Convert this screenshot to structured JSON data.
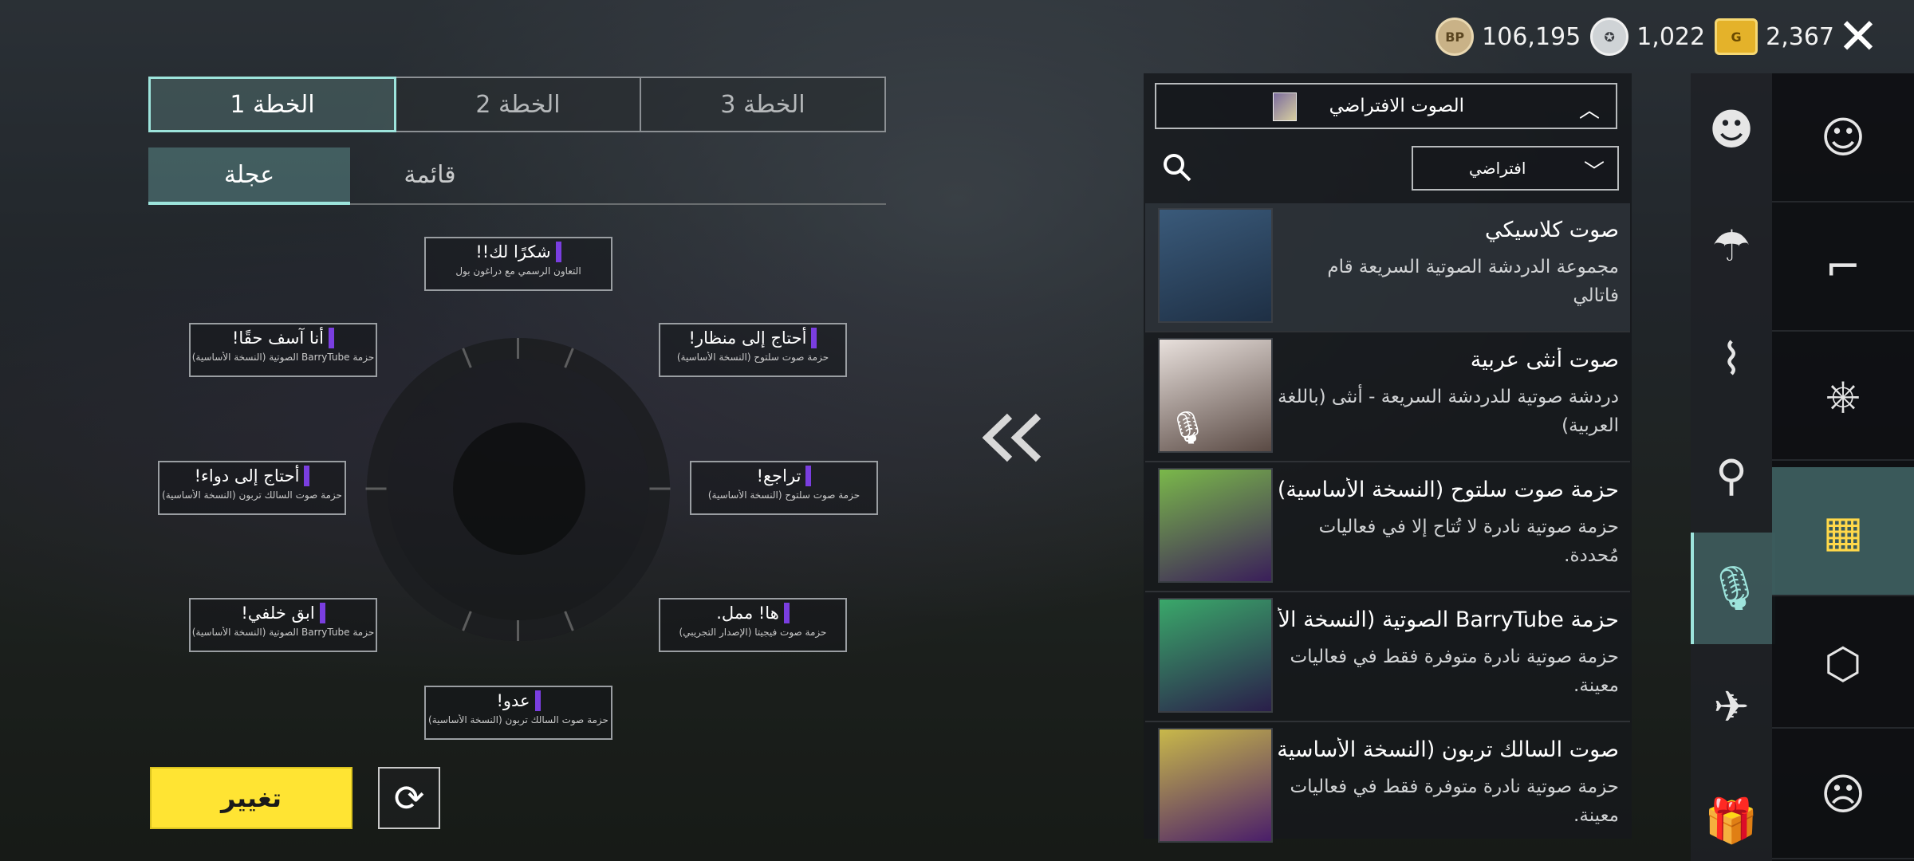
{
  "currency": [
    {
      "icon": "bp-coin-icon",
      "symbol": "BP",
      "value": "106,195"
    },
    {
      "icon": "ag-coin-icon",
      "symbol": "",
      "value": "1,022"
    },
    {
      "icon": "g-coin-icon",
      "symbol": "G",
      "value": "2,367"
    }
  ],
  "close_icon": "close-icon",
  "plans": [
    {
      "label": "الخطة 1",
      "active": true
    },
    {
      "label": "الخطة 2",
      "active": false
    },
    {
      "label": "الخطة 3",
      "active": false
    }
  ],
  "subtabs": {
    "active": "عجلة",
    "inactive": "قائمة"
  },
  "slots": [
    {
      "title": "شكرًا لك!!",
      "sub": "التعاون الرسمي مع دراغون بول"
    },
    {
      "title": "أنا آسف حقًا!",
      "sub": "حزمة BarryTube الصوتية (النسخة الأساسية)"
    },
    {
      "title": "أحتاج إلى منظار!",
      "sub": "حزمة صوت سلتوح (النسخة الأساسية)"
    },
    {
      "title": "أحتاج إلى دواء!",
      "sub": "حزمة صوت السالك تربون (النسخة الأساسية)"
    },
    {
      "title": "تراجع!",
      "sub": "حزمة صوت سلتوح (النسخة الأساسية)"
    },
    {
      "title": "ابق خلفي!",
      "sub": "حزمة BarryTube الصوتية (النسخة الأساسية)"
    },
    {
      "title": "ها! ممل.",
      "sub": "حزمة صوت فيجيتا (الإصدار التجريبي)"
    },
    {
      "title": "عدو!",
      "sub": "حزمة صوت السالك تربون (النسخة الأساسية)"
    }
  ],
  "change_button": "تغيير",
  "refresh_icon": "refresh-icon",
  "panel": {
    "default_voice": "الصوت الافتراضي",
    "filter": "افتراضي",
    "items": [
      {
        "title": "صوت كلاسيكي",
        "desc": "مجموعة الدردشة الصوتية السريعة قام فاتالي",
        "selected": true,
        "thumb_color": "#2a4a6a"
      },
      {
        "title": "صوت أنثى عربية",
        "desc": "دردشة صوتية للدردشة السريعة - أنثى (باللغة العربية)",
        "selected": false,
        "thumb_color": "#d7d0cc"
      },
      {
        "title": "حزمة صوت سلتوح (النسخة الأساسية)",
        "desc": "حزمة صوتية نادرة لا تُتاح إلا في فعاليات مُحددة.",
        "selected": false,
        "thumb_color": "#4a2a6a"
      },
      {
        "title": "حزمة BarryTube الصوتية (النسخة الأساسية)",
        "desc": "حزمة صوتية نادرة متوفرة فقط في فعاليات معينة.",
        "selected": false,
        "thumb_color": "#3a2a5a"
      },
      {
        "title": "صوت السالك تربون (النسخة الأساسية)",
        "desc": "حزمة صوتية نادرة متوفرة فقط في فعاليات معينة.",
        "selected": false,
        "thumb_color": "#4a2a66"
      }
    ]
  },
  "side_categories": [
    "emote-icon",
    "parachute-icon",
    "prone-icon",
    "location-pin-icon",
    "microphone-icon",
    "airplane-icon",
    "gift-box-icon"
  ],
  "side_main": [
    "character-icon",
    "gun-icon",
    "steering-wheel-icon",
    "crate-banner-icon",
    "box-icon",
    "agent-icon"
  ]
}
